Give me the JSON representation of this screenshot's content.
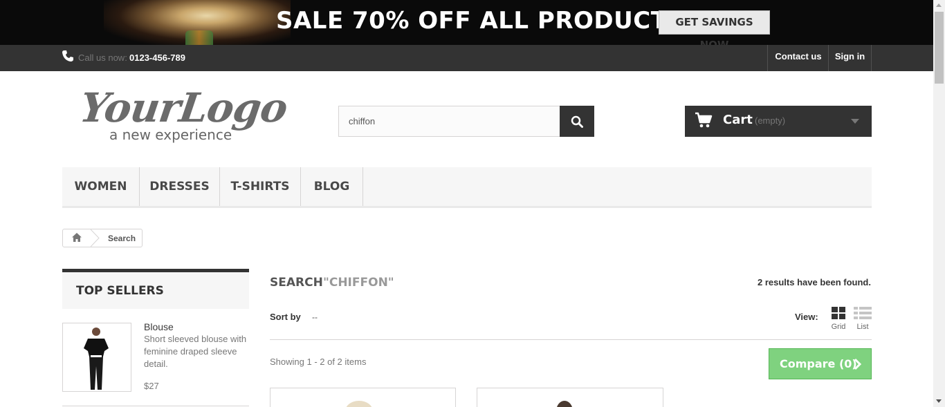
{
  "banner": {
    "text": "SALE 70% OFF ALL PRODUCTS",
    "button_label": "GET SAVINGS NOW"
  },
  "topbar": {
    "call_label": "Call us now:",
    "phone": "0123-456-789",
    "contact_label": "Contact us",
    "signin_label": "Sign in"
  },
  "logo": {
    "main": "YourLogo",
    "tagline": "a new experience"
  },
  "search": {
    "value": "chiffon"
  },
  "cart": {
    "label": "Cart",
    "status": "(empty)"
  },
  "menu": {
    "items": [
      {
        "label": "WOMEN"
      },
      {
        "label": "DRESSES"
      },
      {
        "label": "T-SHIRTS"
      },
      {
        "label": "BLOG"
      }
    ]
  },
  "breadcrumb": {
    "current": "Search"
  },
  "sidebar": {
    "title": "TOP SELLERS",
    "product": {
      "name": "Blouse",
      "description": "Short sleeved blouse with feminine draped sleeve detail.",
      "price": "$27"
    }
  },
  "main": {
    "heading": "SEARCH",
    "term": "\"CHIFFON\"",
    "results": "2 results have been found.",
    "sort_label": "Sort by",
    "sort_value": "--",
    "view_label": "View:",
    "view_grid": "Grid",
    "view_list": "List",
    "showing": "Showing 1 - 2 of 2 items",
    "compare_label": "Compare (0)"
  },
  "colors": {
    "dark": "#333333",
    "compare_green": "#7fd27f",
    "menu_bg": "#f6f6f6"
  }
}
